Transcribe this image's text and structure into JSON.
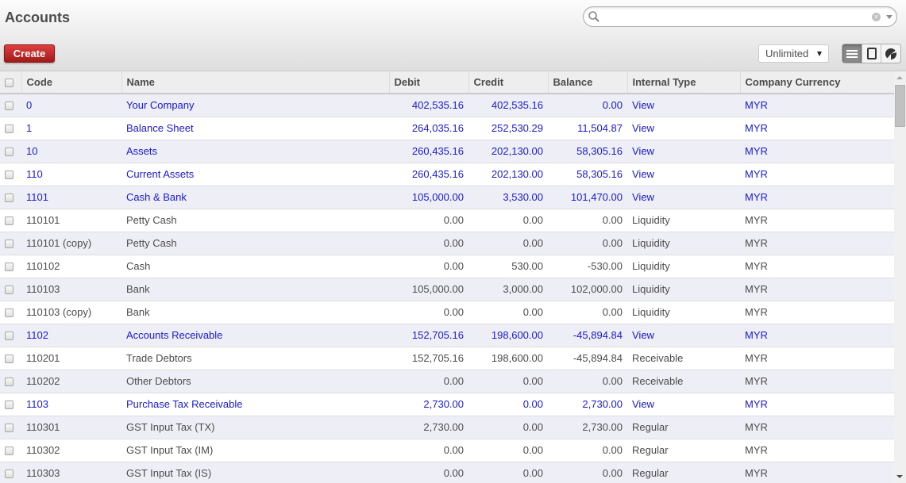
{
  "header": {
    "title": "Accounts",
    "create_label": "Create",
    "search": {
      "value": "",
      "placeholder": ""
    },
    "limit_selected": "Unlimited",
    "views": [
      {
        "name": "list-view",
        "active": true
      },
      {
        "name": "form-view",
        "active": false
      },
      {
        "name": "chart-view",
        "active": false
      }
    ]
  },
  "table": {
    "columns": [
      "Code",
      "Name",
      "Debit",
      "Credit",
      "Balance",
      "Internal Type",
      "Company Currency"
    ],
    "rows": [
      {
        "code": "0",
        "name": "Your Company",
        "debit": "402,535.16",
        "credit": "402,535.16",
        "balance": "0.00",
        "type": "View",
        "currency": "MYR"
      },
      {
        "code": "1",
        "name": "Balance Sheet",
        "debit": "264,035.16",
        "credit": "252,530.29",
        "balance": "11,504.87",
        "type": "View",
        "currency": "MYR"
      },
      {
        "code": "10",
        "name": "Assets",
        "debit": "260,435.16",
        "credit": "202,130.00",
        "balance": "58,305.16",
        "type": "View",
        "currency": "MYR"
      },
      {
        "code": "110",
        "name": "Current Assets",
        "debit": "260,435.16",
        "credit": "202,130.00",
        "balance": "58,305.16",
        "type": "View",
        "currency": "MYR"
      },
      {
        "code": "1101",
        "name": "Cash & Bank",
        "debit": "105,000.00",
        "credit": "3,530.00",
        "balance": "101,470.00",
        "type": "View",
        "currency": "MYR"
      },
      {
        "code": "110101",
        "name": "Petty Cash",
        "debit": "0.00",
        "credit": "0.00",
        "balance": "0.00",
        "type": "Liquidity",
        "currency": "MYR"
      },
      {
        "code": "110101 (copy)",
        "name": "Petty Cash",
        "debit": "0.00",
        "credit": "0.00",
        "balance": "0.00",
        "type": "Liquidity",
        "currency": "MYR"
      },
      {
        "code": "110102",
        "name": "Cash",
        "debit": "0.00",
        "credit": "530.00",
        "balance": "-530.00",
        "type": "Liquidity",
        "currency": "MYR"
      },
      {
        "code": "110103",
        "name": "Bank",
        "debit": "105,000.00",
        "credit": "3,000.00",
        "balance": "102,000.00",
        "type": "Liquidity",
        "currency": "MYR"
      },
      {
        "code": "110103 (copy)",
        "name": "Bank",
        "debit": "0.00",
        "credit": "0.00",
        "balance": "0.00",
        "type": "Liquidity",
        "currency": "MYR"
      },
      {
        "code": "1102",
        "name": "Accounts Receivable",
        "debit": "152,705.16",
        "credit": "198,600.00",
        "balance": "-45,894.84",
        "type": "View",
        "currency": "MYR"
      },
      {
        "code": "110201",
        "name": "Trade Debtors",
        "debit": "152,705.16",
        "credit": "198,600.00",
        "balance": "-45,894.84",
        "type": "Receivable",
        "currency": "MYR"
      },
      {
        "code": "110202",
        "name": "Other Debtors",
        "debit": "0.00",
        "credit": "0.00",
        "balance": "0.00",
        "type": "Receivable",
        "currency": "MYR"
      },
      {
        "code": "1103",
        "name": "Purchase Tax Receivable",
        "debit": "2,730.00",
        "credit": "0.00",
        "balance": "2,730.00",
        "type": "View",
        "currency": "MYR"
      },
      {
        "code": "110301",
        "name": "GST Input Tax (TX)",
        "debit": "2,730.00",
        "credit": "0.00",
        "balance": "2,730.00",
        "type": "Regular",
        "currency": "MYR"
      },
      {
        "code": "110302",
        "name": "GST Input Tax (IM)",
        "debit": "0.00",
        "credit": "0.00",
        "balance": "0.00",
        "type": "Regular",
        "currency": "MYR"
      },
      {
        "code": "110303",
        "name": "GST Input Tax (IS)",
        "debit": "0.00",
        "credit": "0.00",
        "balance": "0.00",
        "type": "Regular",
        "currency": "MYR"
      }
    ]
  },
  "colors": {
    "view_row_text": "#1a1ad8",
    "create_button": "#c02525",
    "odd_row_bg": "#eeeef6"
  }
}
